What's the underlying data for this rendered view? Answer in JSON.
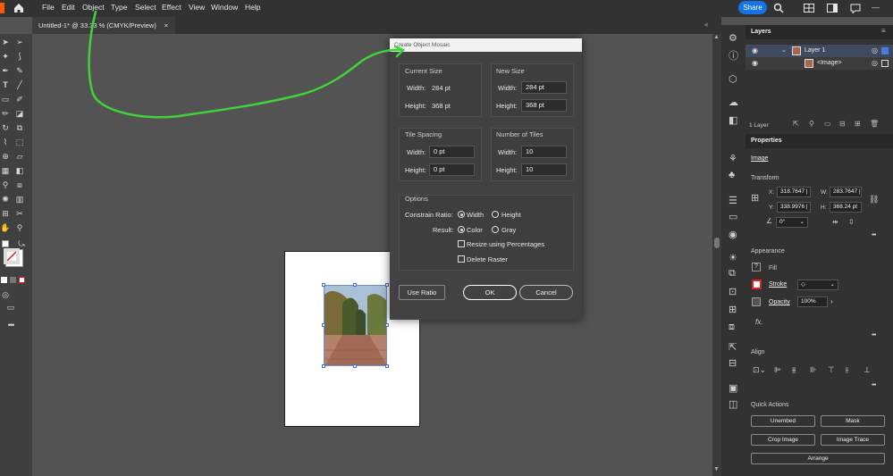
{
  "menu": [
    "File",
    "Edit",
    "Object",
    "Type",
    "Select",
    "Effect",
    "View",
    "Window",
    "Help"
  ],
  "share_label": "Share",
  "doc_tab": {
    "title": "Untitled-1* @ 33.33 % (CMYK/Preview)",
    "close": "×"
  },
  "layers_panel": {
    "tab": "Layers",
    "rows": [
      {
        "name": "Layer 1"
      },
      {
        "name": "<Image>"
      }
    ],
    "count": "1 Layer"
  },
  "properties_panel": {
    "tab": "Properties",
    "object_type": "Image",
    "transform_label": "Transform",
    "x_label": "X:",
    "x_value": "318.7647 |",
    "y_label": "Y:",
    "y_value": "338.9976 |",
    "w_label": "W:",
    "w_value": "283.7647 |",
    "h_label": "H:",
    "h_value": "368.24 pt",
    "angle_value": "0°",
    "appearance_label": "Appearance",
    "fill_label": "Fill",
    "stroke_label": "Stroke",
    "opacity_label": "Opacity",
    "opacity_value": "100%",
    "fx_label": "fx.",
    "align_label": "Align",
    "quick_actions_label": "Quick Actions",
    "quick_actions": [
      "Unembed",
      "Mask",
      "Crop Image",
      "Image Trace",
      "Arrange"
    ]
  },
  "dialog": {
    "title": "Create Object Mosaic",
    "current_size": {
      "label": "Current Size",
      "width_label": "Width:",
      "width": "284 pt",
      "height_label": "Height:",
      "height": "368 pt"
    },
    "new_size": {
      "label": "New Size",
      "width_label": "Width:",
      "width": "284 pt",
      "height_label": "Height:",
      "height": "368 pt"
    },
    "tile_spacing": {
      "label": "Tile Spacing",
      "width_label": "Width:",
      "width": "0 pt",
      "height_label": "Height:",
      "height": "0 pt"
    },
    "number_of_tiles": {
      "label": "Number of Tiles",
      "width_label": "Width:",
      "width": "10",
      "height_label": "Height:",
      "height": "10"
    },
    "options": {
      "label": "Options",
      "constrain_label": "Constrain Ratio:",
      "constrain_options": [
        "Width",
        "Height"
      ],
      "constrain_selected": "Width",
      "result_label": "Result:",
      "result_options": [
        "Color",
        "Gray"
      ],
      "result_selected": "Color",
      "resize_label": "Resize using Percentages",
      "delete_label": "Delete Raster"
    },
    "buttons": {
      "use_ratio": "Use Ratio",
      "ok": "OK",
      "cancel": "Cancel"
    }
  },
  "colors": {
    "accent": "#1473e6",
    "annotation": "#3fd23a",
    "panel": "#323232",
    "canvas": "#535353"
  }
}
